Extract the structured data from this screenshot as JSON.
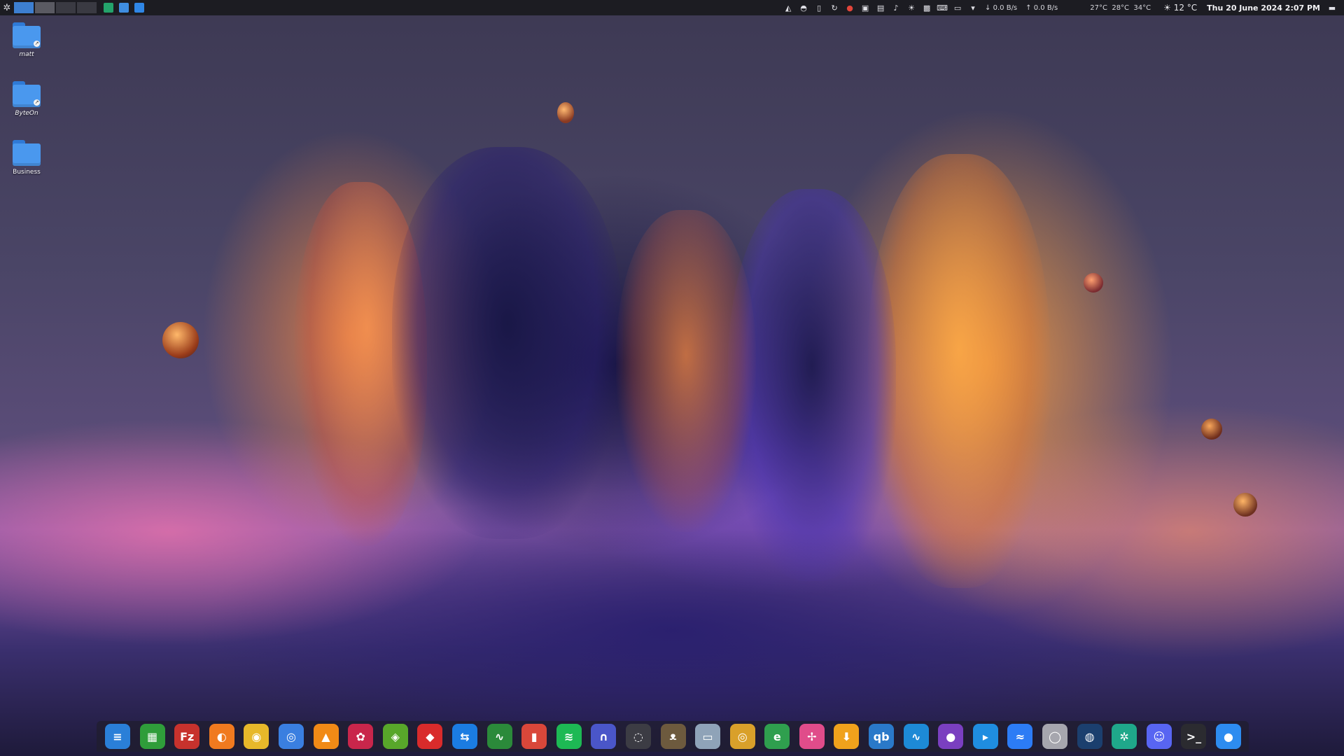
{
  "topbar": {
    "menu_icon": "menu-icon",
    "workspaces": 4,
    "launchers": [
      "activity-monitor-icon",
      "vpn-icon",
      "window-icon"
    ],
    "tray_icons": [
      "network-icon",
      "location-icon",
      "temperature-icon",
      "sync-icon",
      "redshift-icon",
      "clipboard-icon",
      "screens-icon",
      "volume-icon",
      "brightness-icon",
      "capture-icon",
      "keyboard-icon",
      "display-icon",
      "dropdown-icon"
    ],
    "net_down_arrow": "↓",
    "net_down": "0.0 B/s",
    "net_up_arrow": "↑",
    "net_up": "0.0 B/s",
    "temps": "27°C  28°C  34°C",
    "weather": "12 °C",
    "clock": "Thu 20 June 2024 2:07 PM"
  },
  "desktop": {
    "icons": [
      {
        "label": "matt"
      },
      {
        "label": "ByteOn"
      },
      {
        "label": "Business"
      }
    ]
  },
  "dock": {
    "items": [
      {
        "name": "writer-icon",
        "glyph": "≡",
        "color": "#2a7fd8"
      },
      {
        "name": "calc-icon",
        "glyph": "▦",
        "color": "#2f9d3a"
      },
      {
        "name": "filezilla-icon",
        "glyph": "Fz",
        "color": "#c7322d"
      },
      {
        "name": "firefox-icon",
        "glyph": "◐",
        "color": "#f07a1f"
      },
      {
        "name": "chrome-icon",
        "glyph": "◉",
        "color": "#e7b82a"
      },
      {
        "name": "browser-icon",
        "glyph": "◎",
        "color": "#3a7fe0"
      },
      {
        "name": "vlc-icon",
        "glyph": "▲",
        "color": "#f18a16"
      },
      {
        "name": "raspberry-icon",
        "glyph": "✿",
        "color": "#c9264b"
      },
      {
        "name": "nvidia-icon",
        "glyph": "◈",
        "color": "#58a72a"
      },
      {
        "name": "anydesk-icon",
        "glyph": "◆",
        "color": "#d92b2b"
      },
      {
        "name": "teamviewer-icon",
        "glyph": "⇆",
        "color": "#1b7ce2"
      },
      {
        "name": "system-monitor-icon",
        "glyph": "∿",
        "color": "#2b8a3a"
      },
      {
        "name": "paint-icon",
        "glyph": "▮",
        "color": "#d9473a"
      },
      {
        "name": "spotify-icon",
        "glyph": "≋",
        "color": "#1db954"
      },
      {
        "name": "headset-icon",
        "glyph": "∩",
        "color": "#4a56c9"
      },
      {
        "name": "obs-icon",
        "glyph": "◌",
        "color": "#3c3c44"
      },
      {
        "name": "gimp-icon",
        "glyph": "ᴥ",
        "color": "#6d5a3e"
      },
      {
        "name": "jar-icon",
        "glyph": "▭",
        "color": "#8fa3b8"
      },
      {
        "name": "target-icon",
        "glyph": "◎",
        "color": "#d9a02a"
      },
      {
        "name": "edge-icon",
        "glyph": "e",
        "color": "#2f9f4e"
      },
      {
        "name": "pinwheel-icon",
        "glyph": "✢",
        "color": "#e04c8a"
      },
      {
        "name": "download-icon",
        "glyph": "⬇",
        "color": "#f0a21c"
      },
      {
        "name": "qbittorrent-icon",
        "glyph": "qb",
        "color": "#2a79c9"
      },
      {
        "name": "analytics-icon",
        "glyph": "∿",
        "color": "#1d8ad6"
      },
      {
        "name": "podcast-icon",
        "glyph": "●",
        "color": "#7a3fc0"
      },
      {
        "name": "chat-icon",
        "glyph": "▸",
        "color": "#1f8de0"
      },
      {
        "name": "messenger-icon",
        "glyph": "≈",
        "color": "#2c7cf5"
      },
      {
        "name": "disc-icon",
        "glyph": "◯",
        "color": "#a6a6ae"
      },
      {
        "name": "steam-icon",
        "glyph": "◍",
        "color": "#1b3f6e"
      },
      {
        "name": "aperture-icon",
        "glyph": "✲",
        "color": "#1fa88a"
      },
      {
        "name": "discord-icon",
        "glyph": "☺",
        "color": "#5865f2"
      },
      {
        "name": "terminal-icon",
        "glyph": ">_",
        "color": "#2b2b30"
      },
      {
        "name": "messages-icon",
        "glyph": "●",
        "color": "#2d8cf0"
      }
    ]
  }
}
